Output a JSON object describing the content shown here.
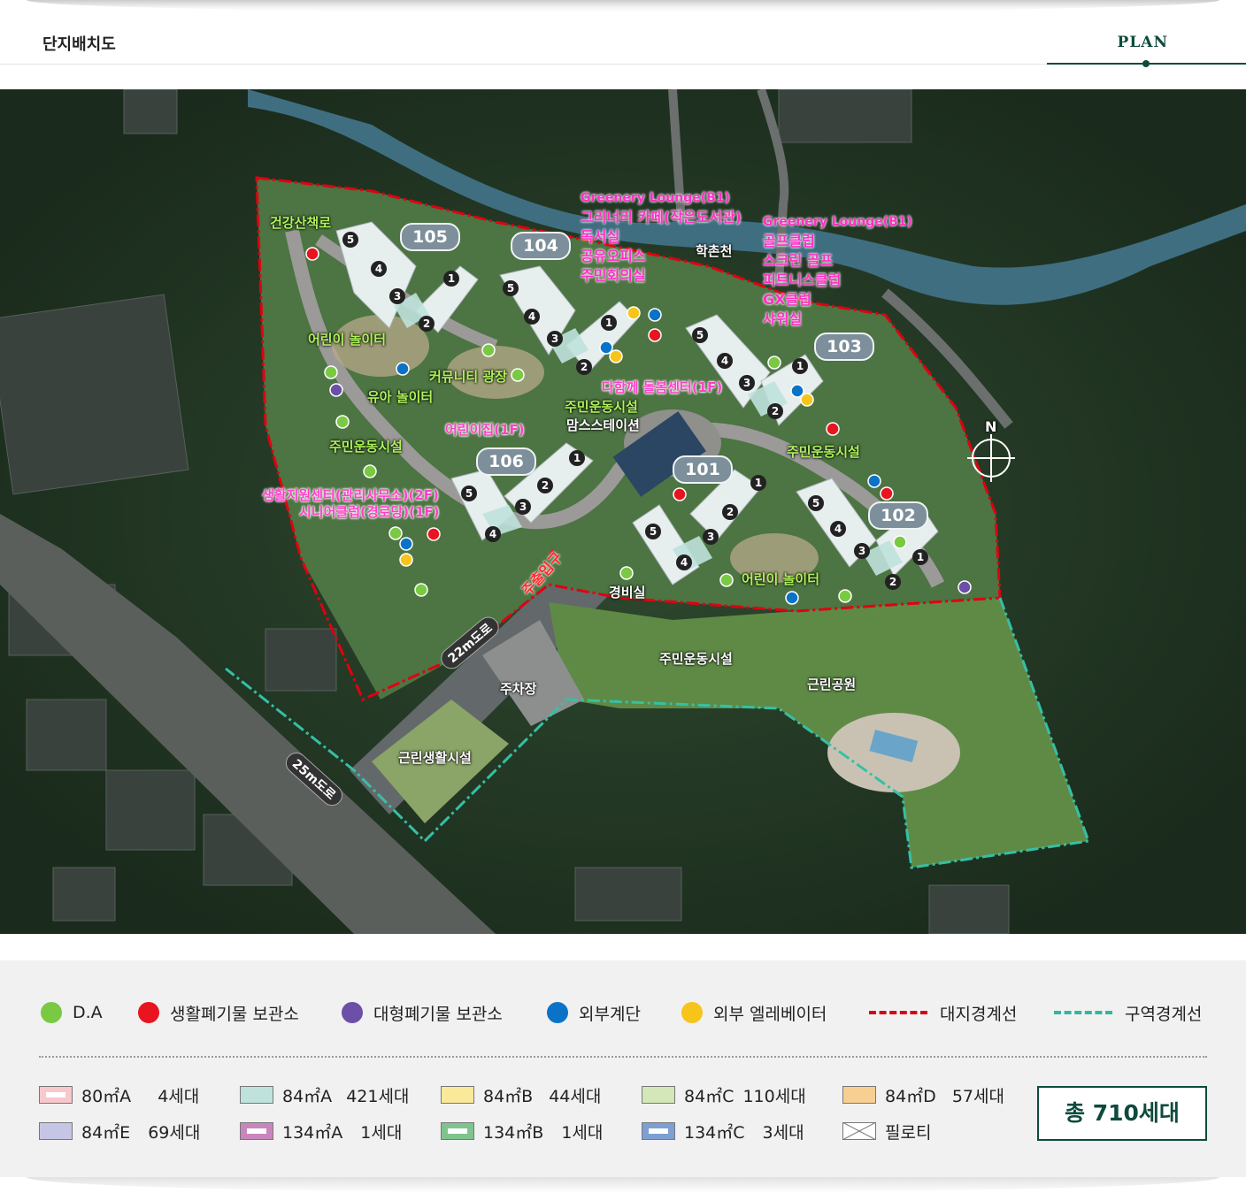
{
  "header": {
    "title": "단지배치도",
    "tab": "PLAN"
  },
  "map": {
    "labels_green": [
      "건강산책로",
      "어린이 놀이터",
      "커뮤니티 광장",
      "유아 놀이터",
      "주민운동시설",
      "주민운동시설",
      "주민운동시설",
      "어린이 놀이터"
    ],
    "labels_white": [
      "맘스스테이션",
      "학촌천",
      "경비실",
      "주민운동시설",
      "주차장",
      "근린생활시설",
      "근린공원"
    ],
    "buildings": [
      "105",
      "104",
      "103",
      "106",
      "101",
      "102"
    ],
    "lounge_left": [
      "Greenery Lounge(B1)",
      "그리너리 카페(작은도서관)",
      "독서실",
      "공유오피스",
      "주민회의실"
    ],
    "lounge_right": [
      "Greenery Lounge(B1)",
      "골프클럽",
      "스크린 골프",
      "피트니스클럽",
      "GX클럽",
      "샤워실"
    ],
    "pink_labels": [
      "다함께 돌봄센터(1F)",
      "어린이집(1F)",
      "생활지원센터(관리사무소)(2F)",
      "시니어클럽(경로당)(1F)"
    ],
    "entrance": "주출입구",
    "roads": [
      "22m도로",
      "25m도로"
    ],
    "compass": "N"
  },
  "legend": {
    "markers": [
      {
        "label": "D.A",
        "color": "#7ac943"
      },
      {
        "label": "생활폐기물 보관소",
        "color": "#e8141f"
      },
      {
        "label": "대형폐기물 보관소",
        "color": "#6b4fa8"
      },
      {
        "label": "외부계단",
        "color": "#0a73c7"
      },
      {
        "label": "외부 엘레베이터",
        "color": "#f7c41a"
      }
    ],
    "lines": [
      {
        "label": "대지경계선",
        "color": "#d7000f"
      },
      {
        "label": "구역경계선",
        "color": "#2fb8a1"
      }
    ],
    "types": [
      {
        "label": "80㎡A",
        "count": "4세대",
        "color": "#f8c8cc",
        "inner": true
      },
      {
        "label": "84㎡A",
        "count": "421세대",
        "color": "#bfe2dc",
        "inner": false
      },
      {
        "label": "84㎡B",
        "count": "44세대",
        "color": "#fbe99a",
        "inner": false
      },
      {
        "label": "84㎡C",
        "count": "110세대",
        "color": "#d4e7b8",
        "inner": false
      },
      {
        "label": "84㎡D",
        "count": "57세대",
        "color": "#f8cf93",
        "inner": false
      },
      {
        "label": "84㎡E",
        "count": "69세대",
        "color": "#c5c6e6",
        "inner": false
      },
      {
        "label": "134㎡A",
        "count": "1세대",
        "color": "#c986bd",
        "inner": true
      },
      {
        "label": "134㎡B",
        "count": "1세대",
        "color": "#7fc38e",
        "inner": true
      },
      {
        "label": "134㎡C",
        "count": "3세대",
        "color": "#7e9fd3",
        "inner": true
      },
      {
        "label": "필로티",
        "count": "",
        "color": "#ffffff",
        "inner": false
      }
    ],
    "total": "총 710세대"
  }
}
